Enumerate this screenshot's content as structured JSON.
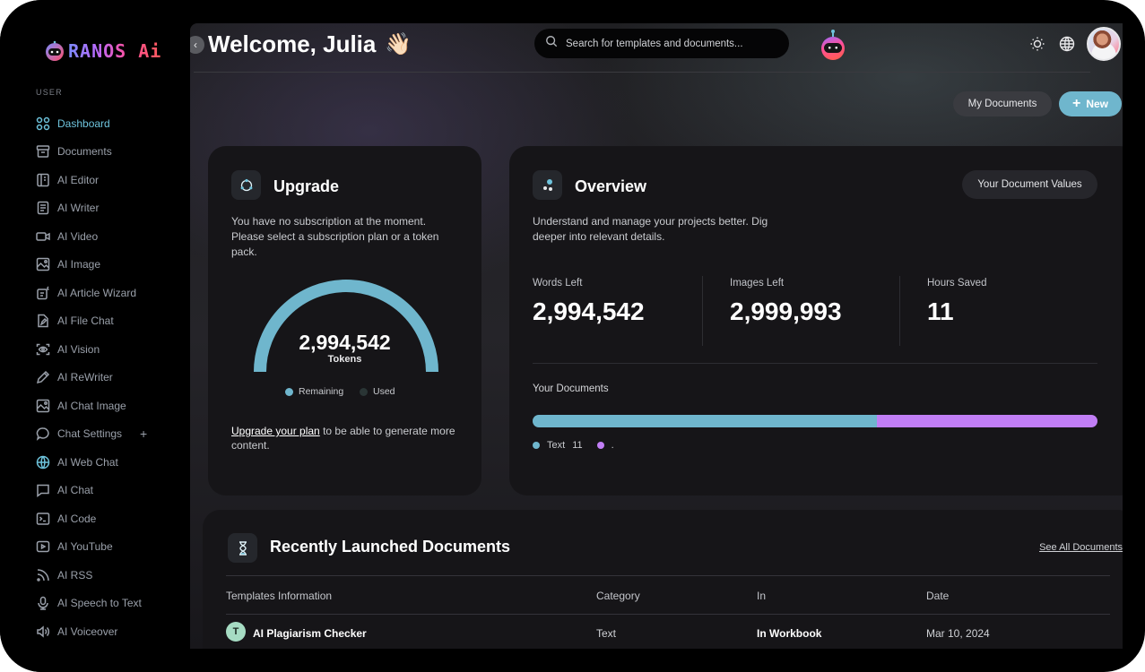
{
  "app": {
    "brand": "RANOS Ai",
    "colors": {
      "accent": "#6ec3dc",
      "accent_button": "#6fb6cd",
      "secondary": "#c17ef5",
      "used": "#2a3535",
      "background": "#000000",
      "card": "#161518"
    }
  },
  "sidebar": {
    "section_label": "USER",
    "items": [
      {
        "label": "Dashboard",
        "icon": "grid-icon",
        "active": true
      },
      {
        "label": "Documents",
        "icon": "archive-icon"
      },
      {
        "label": "AI Editor",
        "icon": "notebook-icon"
      },
      {
        "label": "AI Writer",
        "icon": "document-icon"
      },
      {
        "label": "AI Video",
        "icon": "video-icon"
      },
      {
        "label": "AI Image",
        "icon": "image-icon"
      },
      {
        "label": "AI Article Wizard",
        "icon": "wizard-icon"
      },
      {
        "label": "AI File Chat",
        "icon": "file-edit-icon"
      },
      {
        "label": "AI Vision",
        "icon": "eye-scan-icon"
      },
      {
        "label": "AI ReWriter",
        "icon": "pencil-icon"
      },
      {
        "label": "AI Chat Image",
        "icon": "image-icon"
      },
      {
        "label": "Chat Settings",
        "icon": "chat-bubble-icon",
        "action": "+"
      },
      {
        "label": "AI Web Chat",
        "icon": "www-globe-icon"
      },
      {
        "label": "AI Chat",
        "icon": "message-square-icon"
      },
      {
        "label": "AI Code",
        "icon": "terminal-icon"
      },
      {
        "label": "AI YouTube",
        "icon": "youtube-icon"
      },
      {
        "label": "AI RSS",
        "icon": "rss-icon"
      },
      {
        "label": "AI Speech to Text",
        "icon": "microphone-icon"
      },
      {
        "label": "AI Voiceover",
        "icon": "speaker-icon"
      }
    ]
  },
  "header": {
    "welcome": "Welcome, Julia",
    "wave_emoji": "👋🏻",
    "collapse_glyph": "‹",
    "search_placeholder": "Search for templates and documents...",
    "my_documents_label": "My Documents",
    "new_label": "New",
    "new_glyph": "+"
  },
  "upgrade": {
    "title": "Upgrade",
    "description": "You have no subscription at the moment. Please select a subscription plan or a token pack.",
    "tokens_value": "2,994,542",
    "tokens_unit": "Tokens",
    "remaining_fraction": 1.0,
    "legend_remaining": "Remaining",
    "legend_used": "Used",
    "note_link": "Upgrade your plan",
    "note_rest": " to be able to generate more content."
  },
  "overview": {
    "title": "Overview",
    "button_label": "Your Document Values",
    "description": "Understand and manage your projects better. Dig deeper into relevant details.",
    "stats": [
      {
        "label": "Words Left",
        "value": "2,994,542"
      },
      {
        "label": "Images Left",
        "value": "2,999,993"
      },
      {
        "label": "Hours Saved",
        "value": "11"
      }
    ],
    "documents_label": "Your Documents",
    "documents_breakdown": [
      {
        "label": "Text",
        "count": "11",
        "fraction": 0.61,
        "color": "#6fb6cd"
      },
      {
        "label": ".",
        "count": "",
        "fraction": 0.39,
        "color": "#c17ef5"
      }
    ]
  },
  "recent": {
    "title": "Recently Launched Documents",
    "see_all": "See All Documents",
    "columns": [
      "Templates Information",
      "Category",
      "In",
      "Date"
    ],
    "rows": [
      {
        "avatar": "T",
        "name": "AI Plagiarism Checker",
        "category": "Text",
        "in": "In Workbook",
        "date": "Mar 10, 2024"
      }
    ]
  }
}
